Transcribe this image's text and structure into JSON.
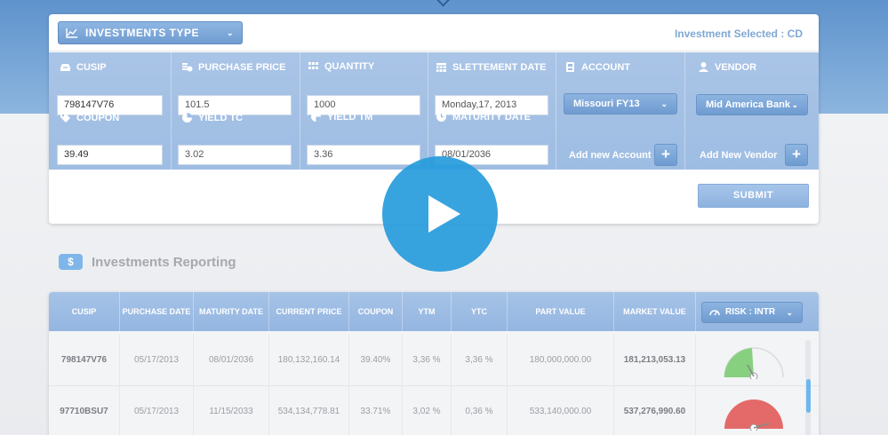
{
  "header": {
    "investment_type_label": "INVESTMENTS TYPE",
    "investment_selected": "Investment Selected : CD"
  },
  "form": {
    "cusip": {
      "label": "CUSIP",
      "value": "798147V76"
    },
    "purchase_price": {
      "label": "PURCHASE PRICE",
      "value": "101.5"
    },
    "quantity": {
      "label": "QUANTITY",
      "value": "1000"
    },
    "settlement_date": {
      "label": "SLETTEMENT DATE",
      "value": "Monday,17, 2013"
    },
    "account": {
      "label": "ACCOUNT",
      "value": "Missouri FY13",
      "add_label": "Add new Account"
    },
    "vendor": {
      "label": "VENDOR",
      "value": "Mid America Bank",
      "add_label": "Add New Vendor"
    },
    "coupon": {
      "label": "COUPON",
      "value": "39.49"
    },
    "yield_tc": {
      "label": "YIELD TC",
      "value": "3.02"
    },
    "yield_tm": {
      "label": "YIELD TM",
      "value": "3.36"
    },
    "maturity_date": {
      "label": "MATURITY DATE",
      "value": "08/01/2036"
    },
    "submit_label": "SUBMIT"
  },
  "reporting": {
    "title": "Investments Reporting",
    "icon_text": "$",
    "columns": [
      "CUSIP",
      "PURCHASE DATE",
      "MATURITY DATE",
      "CURRENT PRICE",
      "COUPON",
      "YTM",
      "YTC",
      "PART VALUE",
      "MARKET VALUE"
    ],
    "risk_select": "RISK : INTR",
    "rows": [
      {
        "cusip": "798147V76",
        "purchase_date": "05/17/2013",
        "maturity_date": "08/01/2036",
        "current_price": "180,132,160.14",
        "coupon": "39.40%",
        "ytm": "3,36 %",
        "ytc": "3,36 %",
        "part_value": "180,000,000.00",
        "market_value": "181,213,053.13",
        "risk_color": "#7fd07a"
      },
      {
        "cusip": "97710BSU7",
        "purchase_date": "05/17/2013",
        "maturity_date": "11/15/2033",
        "current_price": "534,134,778.81",
        "coupon": "33.71%",
        "ytm": "3,02 %",
        "ytc": "0,36 %",
        "part_value": "533,140,000.00",
        "market_value": "537,276,990.60",
        "risk_color": "#e05a5a"
      }
    ]
  },
  "colors": {
    "accent": "#6f9bd0",
    "play": "#269bdc"
  }
}
